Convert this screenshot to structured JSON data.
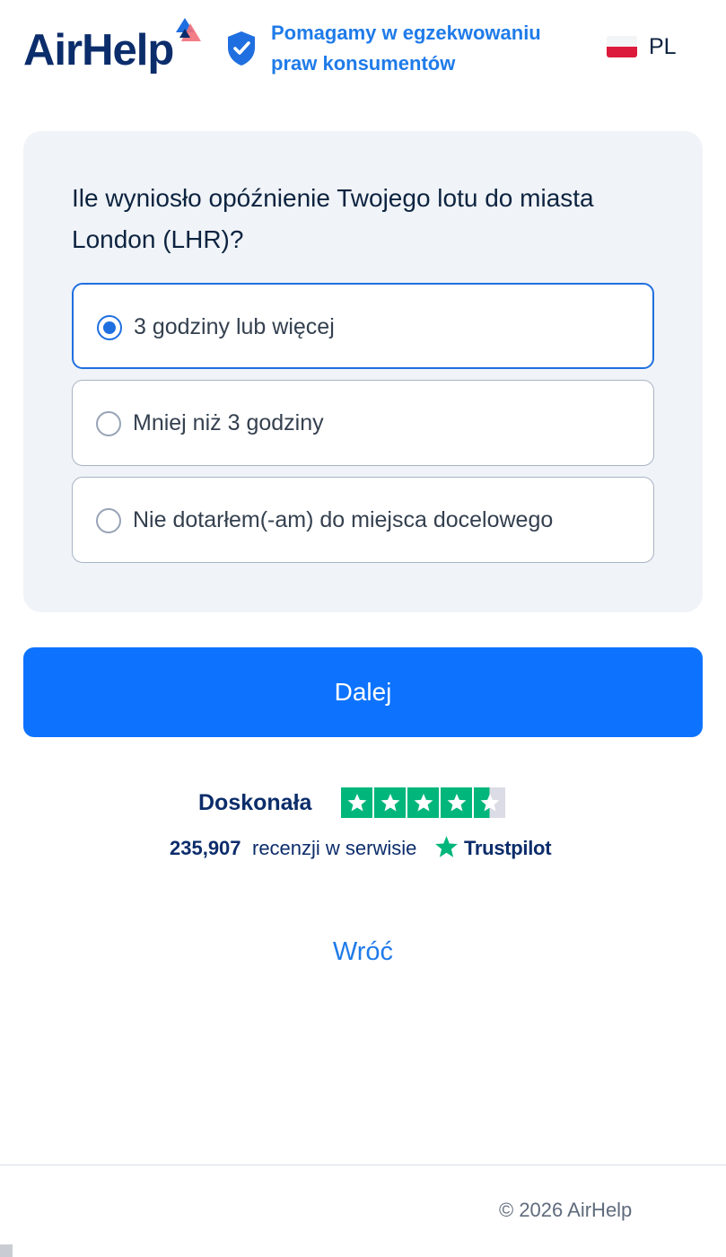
{
  "header": {
    "logo_text": "AirHelp",
    "trust_line1": "Pomagamy w egzekwowaniu",
    "trust_line2": "praw konsumentów",
    "language_code": "PL",
    "flag": "poland-flag-icon"
  },
  "question": {
    "text": "Ile wyniosło opóźnienie Twojego lotu do miasta London (LHR)?",
    "options": [
      {
        "label": "3 godziny lub więcej",
        "selected": true
      },
      {
        "label": "Mniej niż 3 godziny",
        "selected": false
      },
      {
        "label": "Nie dotarłem(-am) do miejsca docelowego",
        "selected": false
      }
    ]
  },
  "next_button_label": "Dalej",
  "trustpilot": {
    "rating_label": "Doskonała",
    "stars": 4.5,
    "reviews_count": "235,907",
    "reviews_text": "recenzji w serwisie",
    "brand": "Trustpilot"
  },
  "back_link_label": "Wróć",
  "footer": {
    "copyright": "© 2026 AirHelp"
  },
  "colors": {
    "brand_navy": "#0c2d6b",
    "accent_blue": "#0d73ff",
    "link_blue": "#1f7be9",
    "trustpilot_green": "#00b67a",
    "card_bg": "#f0f3f7"
  }
}
